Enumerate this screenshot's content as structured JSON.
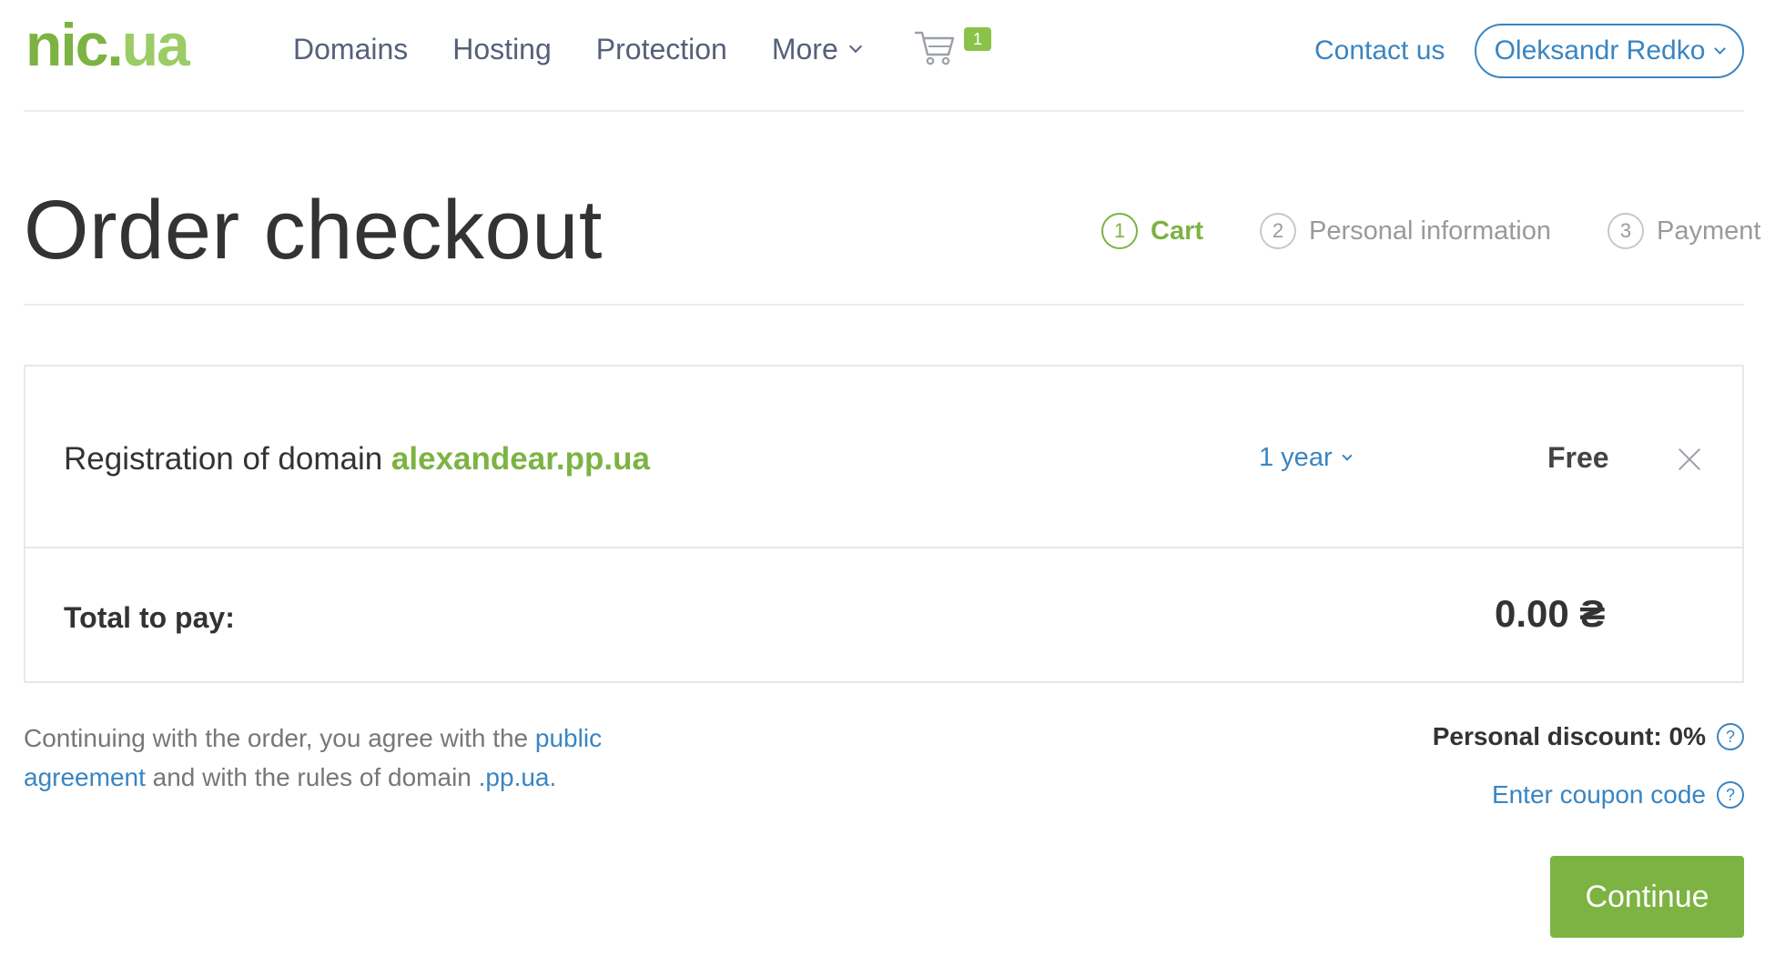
{
  "header": {
    "logo_part1": "nic.",
    "logo_part2": "ua",
    "nav": [
      "Domains",
      "Hosting",
      "Protection",
      "More"
    ],
    "cart_count": "1",
    "contact": "Contact us",
    "user": "Oleksandr Redko"
  },
  "page": {
    "title": "Order checkout",
    "steps": [
      {
        "num": "1",
        "label": "Cart",
        "active": true
      },
      {
        "num": "2",
        "label": "Personal information",
        "active": false
      },
      {
        "num": "3",
        "label": "Payment",
        "active": false
      }
    ]
  },
  "order": {
    "item_prefix": "Registration of domain ",
    "domain": "alexandear.pp.ua",
    "period": "1 year",
    "price": "Free",
    "total_label": "Total to pay:",
    "total_value": "0.00 ₴"
  },
  "footer": {
    "agreement_text1": "Continuing with the order, you agree with the ",
    "agreement_link1": "public agreement",
    "agreement_text2": " and with the rules of domain ",
    "agreement_link2": ".pp.ua",
    "agreement_text3": ".",
    "discount": "Personal discount: 0%",
    "coupon": "Enter coupon code",
    "help_glyph": "?",
    "continue": "Continue"
  },
  "colors": {
    "accent_green": "#7cb342",
    "link_blue": "#3a85c1"
  }
}
